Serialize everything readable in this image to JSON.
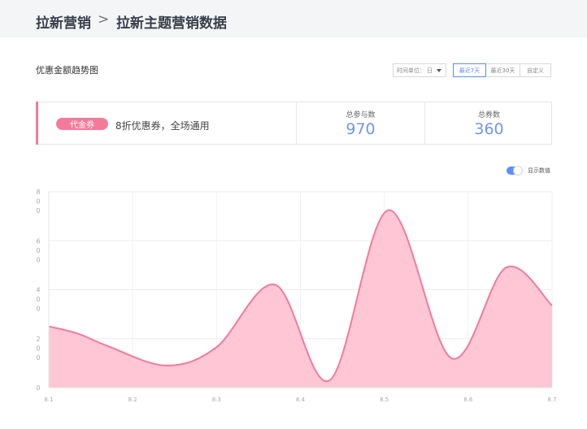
{
  "header": {
    "breadcrumb": [
      "拉新营销",
      "拉新主题营销数据"
    ],
    "separator": ">"
  },
  "section": {
    "title": "优惠金额趋势图"
  },
  "controls": {
    "time_unit_label": "时间单位：",
    "time_unit_value": "日",
    "ranges": [
      "最近7天",
      "最近30天",
      "自定义"
    ],
    "active_range": "最近7天"
  },
  "summary": {
    "badge": "代金券",
    "description": "8折优惠券，全场通用",
    "stats": [
      {
        "label": "总参与数",
        "value": "970"
      },
      {
        "label": "总券数",
        "value": "360"
      }
    ]
  },
  "toggle": {
    "label": "显示数值",
    "on": true
  },
  "colors": {
    "accent": "#f47a9a",
    "area_fill": "#ffc7d6",
    "stat_value": "#6f97f0",
    "toggle_on": "#5b8ff9"
  },
  "chart_data": {
    "type": "area",
    "x": [
      "8.1",
      "8.2",
      "8.3",
      "8.4",
      "8.5",
      "8.6",
      "8.7"
    ],
    "points": [
      {
        "x": 1.0,
        "y": 250
      },
      {
        "x": 1.35,
        "y": 220
      },
      {
        "x": 1.7,
        "y": 170
      },
      {
        "x": 2.4,
        "y": 90
      },
      {
        "x": 3.0,
        "y": 165
      },
      {
        "x": 3.7,
        "y": 420
      },
      {
        "x": 4.35,
        "y": 30
      },
      {
        "x": 5.05,
        "y": 725
      },
      {
        "x": 5.8,
        "y": 120
      },
      {
        "x": 6.45,
        "y": 490
      },
      {
        "x": 7.0,
        "y": 335
      }
    ],
    "ylim": [
      0,
      800
    ],
    "yticks": [
      {
        "value": 0,
        "label": "0"
      },
      {
        "value": 200,
        "label": "200"
      },
      {
        "value": 400,
        "label": "400"
      },
      {
        "value": 600,
        "label": "600"
      },
      {
        "value": 800,
        "label": "800"
      }
    ],
    "grid": true,
    "legend": "none"
  }
}
